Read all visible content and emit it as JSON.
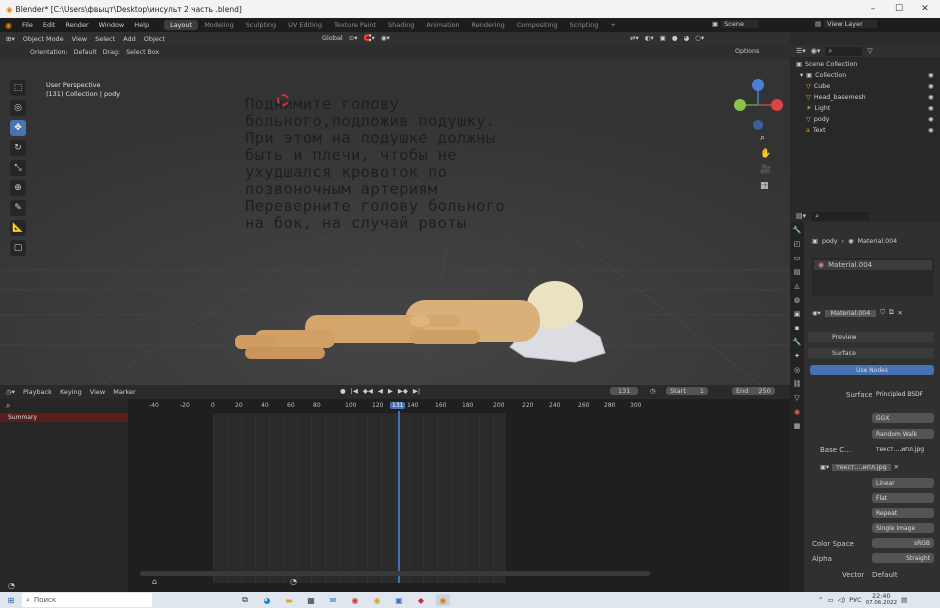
{
  "window": {
    "title": "Blender* [C:\\Users\\фвыцт\\Desktop\\инсульт 2 часть .blend]",
    "minimize": "–",
    "maximize": "☐",
    "close": "✕"
  },
  "menu": {
    "items": [
      "File",
      "Edit",
      "Render",
      "Window",
      "Help"
    ],
    "workspaces": [
      "Layout",
      "Modeling",
      "Sculpting",
      "UV Editing",
      "Texture Paint",
      "Shading",
      "Animation",
      "Rendering",
      "Compositing",
      "Scripting",
      "+"
    ],
    "scene": "Scene",
    "view_layer": "View Layer"
  },
  "viewport_header": {
    "mode": "Object Mode",
    "view": "View",
    "select": "Select",
    "add": "Add",
    "object": "Object",
    "orientation_transform": "Global"
  },
  "tool_header": {
    "orientation_label": "Orientation:",
    "orientation_value": "Default",
    "drag_label": "Drag:",
    "drag_value": "Select Box",
    "options": "Options"
  },
  "viewport": {
    "perspective": "User Perspective",
    "collection_info": "(131) Collection | pody",
    "overlay_text": "Поднимите голову\nбольного,подложив подушку.\nПри этом на подушке должны\nбыть и плечи, чтобы не\nухудшался кровоток по\nпозвоночным артериям\nПереверните голову больного\nна бок, на случай рвоты"
  },
  "timeline": {
    "playback": "Playback",
    "keying": "Keying",
    "view": "View",
    "marker": "Marker",
    "current_frame": "131",
    "start_label": "Start",
    "start": "1",
    "end_label": "End",
    "end": "250",
    "summary": "Summary",
    "ticks": [
      "-40",
      "-20",
      "0",
      "20",
      "40",
      "60",
      "80",
      "100",
      "120",
      "131",
      "140",
      "160",
      "180",
      "200",
      "220",
      "240",
      "260",
      "280",
      "300"
    ]
  },
  "outliner": {
    "root": "Scene Collection",
    "collection": "Collection",
    "items": [
      {
        "name": "Cube",
        "color": "#e09a3a"
      },
      {
        "name": "Head_basemesh",
        "color": "#e09a3a"
      },
      {
        "name": "Light",
        "color": "#e0b040"
      },
      {
        "name": "pody",
        "color": "#e09a3a"
      },
      {
        "name": "Text",
        "color": "#e09a3a"
      }
    ]
  },
  "properties": {
    "breadcrumb_object": "pody",
    "breadcrumb_material": "Material.004",
    "material_slot": "Material.004",
    "material_name": "Material.004",
    "preview": "Preview",
    "surface_panel": "Surface",
    "use_nodes": "Use Nodes",
    "surface_label": "Surface",
    "surface_value": "Principled BSDF",
    "distribution": "GGX",
    "subsurface": "Random Walk",
    "base_color_label": "Base C...",
    "base_color_value": "текст....ипл.jpg",
    "image_name": "текст....ипл.jpg",
    "interpolation": "Linear",
    "projection": "Flat",
    "extension": "Repeat",
    "source": "Single Image",
    "color_space_label": "Color Space",
    "color_space_value": "sRGB",
    "alpha_label": "Alpha",
    "alpha_value": "Straight",
    "vector_label": "Vector",
    "vector_value": "Default"
  },
  "taskbar": {
    "search_placeholder": "Поиск",
    "lang": "РУС",
    "time": "22:40",
    "date": "07.06.2022"
  },
  "colors": {
    "accent": "#4772b3",
    "timeline_cursor": "#4772b3",
    "title_bg": "#f3f3f3"
  }
}
